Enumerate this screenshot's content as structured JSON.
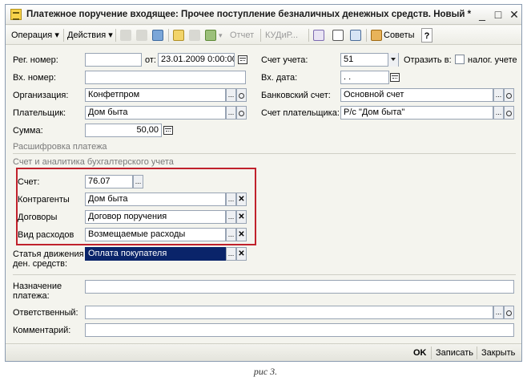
{
  "window": {
    "title": "Платежное поручение входящее: Прочее поступление безналичных денежных средств. Новый *",
    "minimize": "_",
    "maximize": "□",
    "close": "✕"
  },
  "toolbar": {
    "operation": "Операция ▾",
    "actions": "Действия ▾",
    "report": "Отчет",
    "kudir": "КУДиР...",
    "advice": "Советы",
    "help": "?"
  },
  "form": {
    "reg_number": {
      "label": "Рег. номер:",
      "value": ""
    },
    "from": {
      "label": "от:",
      "value": "23.01.2009 0:00:00"
    },
    "account": {
      "label": "Счет учета:",
      "value": "51"
    },
    "reflect": {
      "label": "Отразить в:",
      "checkbox_label": "налог. учете"
    },
    "in_number": {
      "label": "Вх. номер:",
      "value": ""
    },
    "in_date": {
      "label": "Вх. дата:",
      "value": " .  ."
    },
    "organization": {
      "label": "Организация:",
      "value": "Конфетпром"
    },
    "bank_account": {
      "label": "Банковский счет:",
      "value": "Основной счет"
    },
    "payer": {
      "label": "Плательщик:",
      "value": "Дом быта"
    },
    "payer_account": {
      "label": "Счет плательщика:",
      "value": "Р/с \"Дом быта\""
    },
    "sum": {
      "label": "Сумма:",
      "value": "50,00"
    },
    "section_decode": "Расшифровка платежа",
    "section_accounting": "Счет и аналитика бухгалтерского учета",
    "schet": {
      "label": "Счет:",
      "value": "76.07"
    },
    "contragents": {
      "label": "Контрагенты",
      "value": "Дом быта"
    },
    "contracts": {
      "label": "Договоры",
      "value": "Договор поручения"
    },
    "expense_type": {
      "label": "Вид расходов",
      "value": "Возмещаемые расходы"
    },
    "cash_flow": {
      "label_line1": "Статья движения",
      "label_line2": "ден. средств:",
      "value": "Оплата покупателя"
    },
    "purpose": {
      "label_line1": "Назначение",
      "label_line2": "платежа:",
      "value": ""
    },
    "responsible": {
      "label": "Ответственный:",
      "value": ""
    },
    "comment": {
      "label": "Комментарий:",
      "value": ""
    }
  },
  "footer": {
    "ok": "OK",
    "save": "Записать",
    "close": "Закрыть"
  },
  "caption": "рис 3."
}
